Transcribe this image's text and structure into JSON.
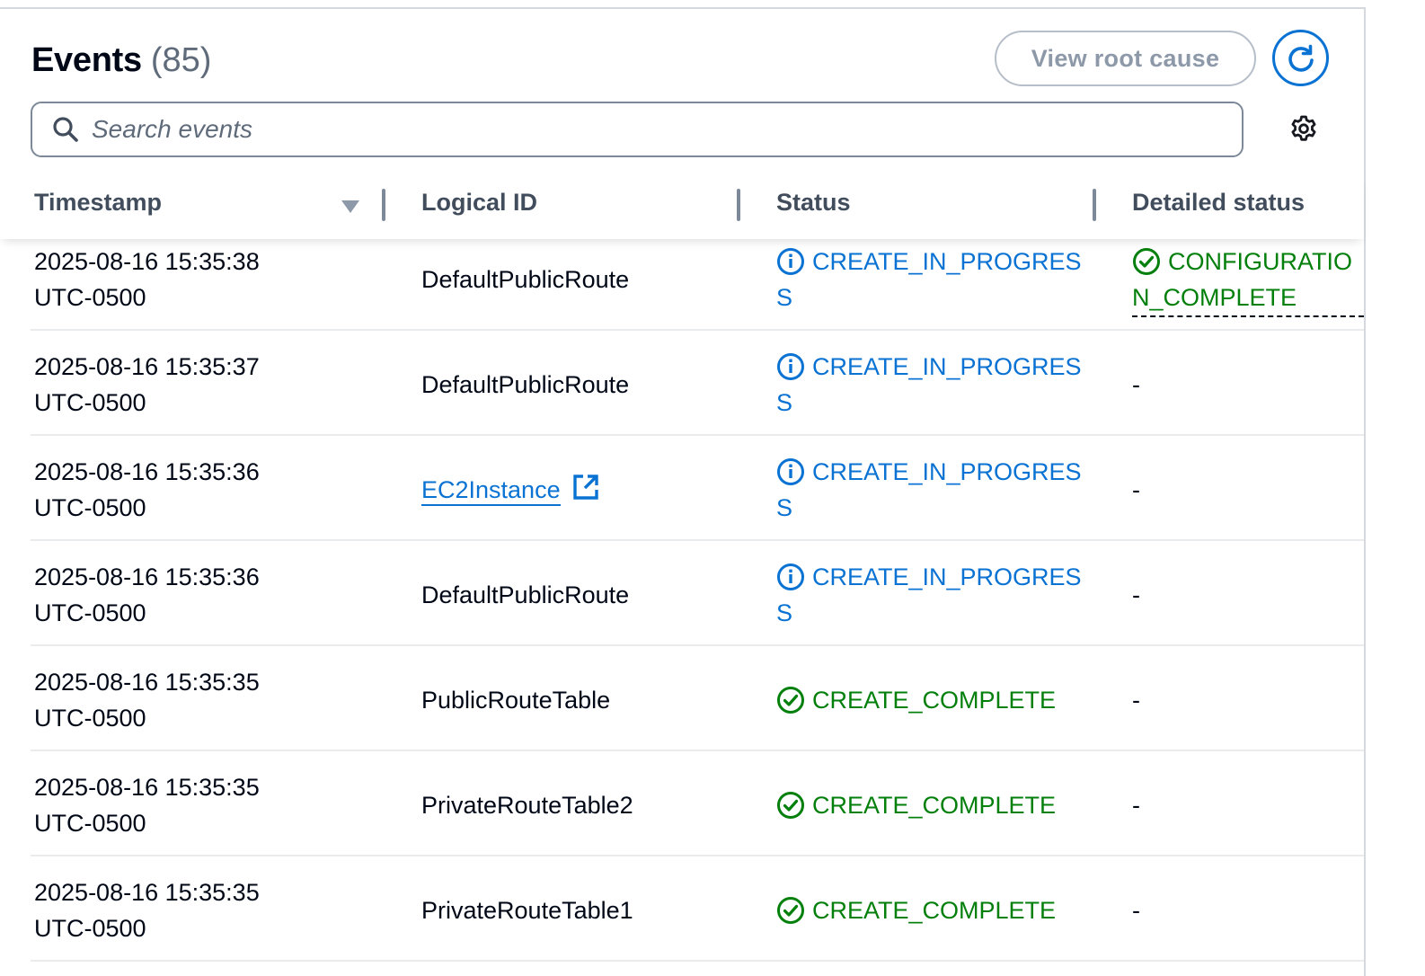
{
  "header": {
    "title": "Events",
    "count": "(85)",
    "view_root_cause_label": "View root cause"
  },
  "search": {
    "placeholder": "Search events",
    "value": ""
  },
  "table": {
    "columns": [
      "Timestamp",
      "Logical ID",
      "Status",
      "Detailed status"
    ],
    "sort_column": "Timestamp",
    "rows": [
      {
        "ts_date": "2025-08-16 15:35:38",
        "ts_tz": "UTC-0500",
        "logical_id": "DefaultPublicRoute",
        "status": "CREATE_IN_PROGRESS",
        "detailed_status": "CONFIGURATION_COMPLETE"
      },
      {
        "ts_date": "2025-08-16 15:35:37",
        "ts_tz": "UTC-0500",
        "logical_id": "DefaultPublicRoute",
        "status": "CREATE_IN_PROGRESS",
        "detailed_status": "-"
      },
      {
        "ts_date": "2025-08-16 15:35:36",
        "ts_tz": "UTC-0500",
        "logical_id": "EC2Instance",
        "status": "CREATE_IN_PROGRESS",
        "detailed_status": "-"
      },
      {
        "ts_date": "2025-08-16 15:35:36",
        "ts_tz": "UTC-0500",
        "logical_id": "DefaultPublicRoute",
        "status": "CREATE_IN_PROGRESS",
        "detailed_status": "-"
      },
      {
        "ts_date": "2025-08-16 15:35:35",
        "ts_tz": "UTC-0500",
        "logical_id": "PublicRouteTable",
        "status": "CREATE_COMPLETE",
        "detailed_status": "-"
      },
      {
        "ts_date": "2025-08-16 15:35:35",
        "ts_tz": "UTC-0500",
        "logical_id": "PrivateRouteTable2",
        "status": "CREATE_COMPLETE",
        "detailed_status": "-"
      },
      {
        "ts_date": "2025-08-16 15:35:35",
        "ts_tz": "UTC-0500",
        "logical_id": "PrivateRouteTable1",
        "status": "CREATE_COMPLETE",
        "detailed_status": "-"
      }
    ]
  },
  "icons": {
    "refresh": "refresh-icon",
    "search": "search-icon",
    "settings": "gear-icon",
    "sort": "sort-descending-icon",
    "in_progress": "info-circle-icon",
    "complete": "check-circle-icon",
    "external_link": "external-link-icon"
  },
  "colors": {
    "primary": "#0972d3",
    "success": "#037f0c",
    "text": "#000716",
    "muted": "#5f6b7a"
  }
}
